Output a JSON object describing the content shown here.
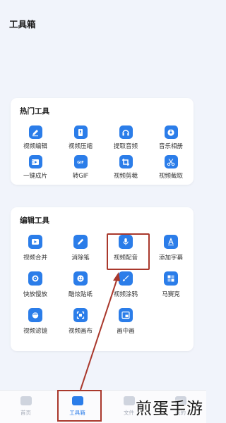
{
  "header": {
    "title": "工具箱"
  },
  "hot_tools": {
    "title": "热门工具",
    "items": [
      {
        "label": "视频编辑",
        "icon": "edit-video-icon"
      },
      {
        "label": "视频压缩",
        "icon": "compress-icon"
      },
      {
        "label": "提取音频",
        "icon": "headphones-icon"
      },
      {
        "label": "音乐相册",
        "icon": "music-album-icon"
      },
      {
        "label": "一键成片",
        "icon": "film-strip-icon"
      },
      {
        "label": "转GIF",
        "icon": "gif-icon"
      },
      {
        "label": "视频剪裁",
        "icon": "crop-icon"
      },
      {
        "label": "视频截取",
        "icon": "scissors-icon"
      }
    ]
  },
  "edit_tools": {
    "title": "编辑工具",
    "items": [
      {
        "label": "视频合并",
        "icon": "play-merge-icon"
      },
      {
        "label": "消除笔",
        "icon": "pen-icon"
      },
      {
        "label": "视频配音",
        "icon": "microphone-icon"
      },
      {
        "label": "添加字幕",
        "icon": "text-a-icon"
      },
      {
        "label": "快放慢放",
        "icon": "speed-icon"
      },
      {
        "label": "酷炫贴纸",
        "icon": "sticker-smile-icon"
      },
      {
        "label": "视频涂鸦",
        "icon": "brush-icon"
      },
      {
        "label": "马赛克",
        "icon": "mosaic-icon"
      },
      {
        "label": "视频滤镜",
        "icon": "filter-icon"
      },
      {
        "label": "视频画布",
        "icon": "canvas-icon"
      },
      {
        "label": "画中画",
        "icon": "picture-in-picture-icon"
      }
    ]
  },
  "bottom_nav": {
    "items": [
      {
        "label": "首页"
      },
      {
        "label": "工具箱"
      },
      {
        "label": "文件"
      },
      {
        "label": "我的"
      }
    ],
    "active_index": 1
  },
  "watermark": "煎蛋手游",
  "colors": {
    "accent": "#2b7de9",
    "highlight": "#a9382c",
    "background": "#f1f4fb"
  }
}
